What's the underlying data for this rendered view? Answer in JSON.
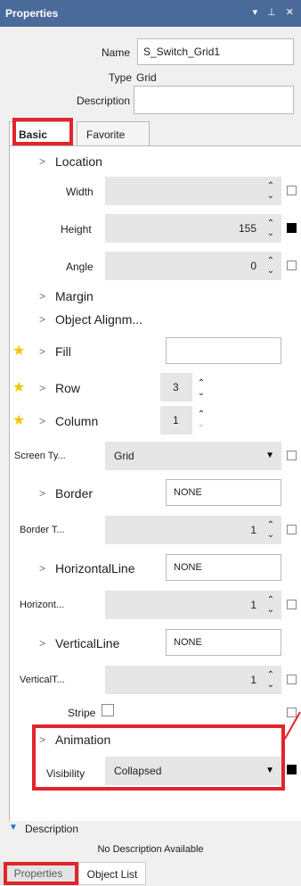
{
  "window": {
    "title": "Properties",
    "controls": "▾ ⊥ ✕"
  },
  "header": {
    "name_label": "Name",
    "name_value": "S_Switch_Grid1",
    "type_label": "Type",
    "type_value": "Grid",
    "description_label": "Description",
    "description_value": ""
  },
  "tabs": [
    {
      "label": "Basic"
    },
    {
      "label": "Favorite"
    }
  ],
  "props": {
    "location": "Location",
    "width_label": "Width",
    "width_value": "",
    "height_label": "Height",
    "height_value": "155",
    "angle_label": "Angle",
    "angle_value": "0",
    "margin": "Margin",
    "object_alignment": "Object Alignm...",
    "fill": "Fill",
    "fill_value": "",
    "row": "Row",
    "row_value": "3",
    "column": "Column",
    "column_value": "1",
    "screen_type_label": "Screen Ty...",
    "screen_type_value": "Grid",
    "border": "Border",
    "border_value": "NONE",
    "border_t_label": "Border T...",
    "border_t_value": "1",
    "hline": "HorizontalLine",
    "hline_value": "NONE",
    "hline_t_label": "Horizont...",
    "hline_t_value": "1",
    "vline": "VerticalLine",
    "vline_value": "NONE",
    "vline_t_label": "VerticalT...",
    "vline_t_value": "1",
    "stripe_label": "Stripe",
    "animation": "Animation",
    "visibility_label": "Visibility",
    "visibility_value": "Collapsed"
  },
  "footer": {
    "description_header": "Description",
    "no_description": "No Description Available",
    "tabs": [
      {
        "label": "Properties"
      },
      {
        "label": "Object List"
      }
    ]
  },
  "colors": {
    "titlebar": "#4a6a9a",
    "highlight": "#e3242b",
    "star": "#f5c400"
  }
}
